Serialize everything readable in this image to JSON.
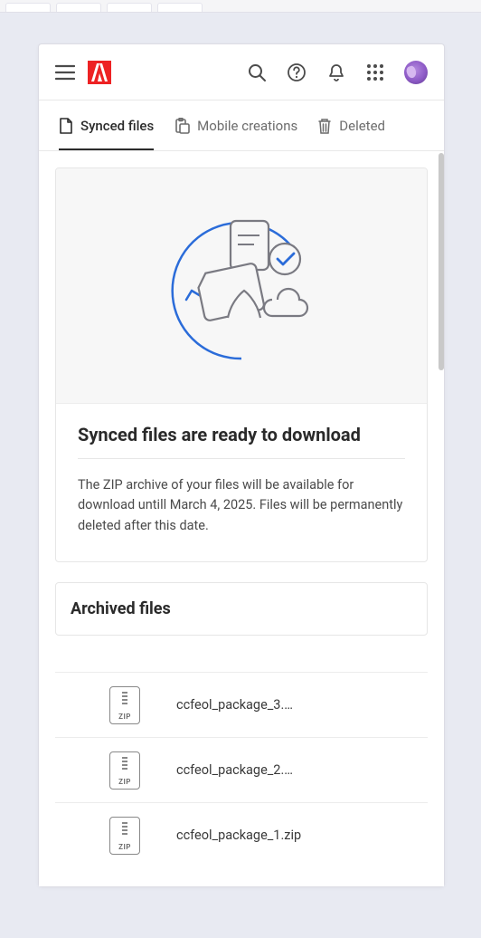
{
  "tabs": [
    {
      "label": "Synced files",
      "icon": "file-icon",
      "active": true
    },
    {
      "label": "Mobile creations",
      "icon": "clipboard-icon",
      "active": false
    },
    {
      "label": "Deleted",
      "icon": "trash-icon",
      "active": false
    }
  ],
  "hero": {
    "title": "Synced files are ready to download",
    "body": "The ZIP archive of your files will be available for download untill March 4, 2025. Files will be permanently deleted after this date."
  },
  "archived": {
    "title": "Archived files",
    "files": [
      {
        "name": "ccfeol_package_3.…"
      },
      {
        "name": "ccfeol_package_2.…"
      },
      {
        "name": "ccfeol_package_1.zip"
      }
    ]
  }
}
